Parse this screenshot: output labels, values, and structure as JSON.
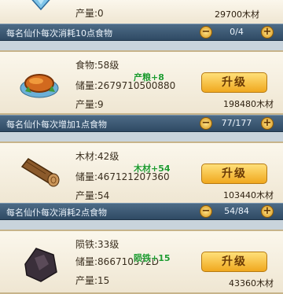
{
  "top": {
    "output_label": "产量:0",
    "cost": "29700木材"
  },
  "bars": [
    {
      "desc": "每名仙仆每次消耗10点食物",
      "count": "0/4",
      "minus": "−",
      "plus": "+"
    },
    {
      "desc": "每名仙仆每次增加1点食物",
      "count": "77/177",
      "minus": "−",
      "plus": "+"
    },
    {
      "desc": "每名仙仆每次消耗2点食物",
      "count": "54/84",
      "minus": "−",
      "plus": "+"
    }
  ],
  "items": [
    {
      "name": "食物:58级",
      "storage": "储量:2679710500880",
      "output": "产量:9",
      "upgrade": "升级",
      "cost": "198480木材",
      "float_text": "产粮+8"
    },
    {
      "name": "木材:42级",
      "storage": "储量:467121207360",
      "output": "产量:54",
      "upgrade": "升级",
      "cost": "103440木材",
      "float_text": "木材+54"
    },
    {
      "name": "陨铁:33级",
      "storage": "储量:866710572D",
      "output": "产量:15",
      "upgrade": "升级",
      "cost": "43360木材",
      "float_text": "陨铁+15"
    }
  ],
  "icons": {
    "gem": "gem-icon",
    "food": "roast-food-icon",
    "wood": "log-icon",
    "iron": "meteor-iron-icon"
  }
}
